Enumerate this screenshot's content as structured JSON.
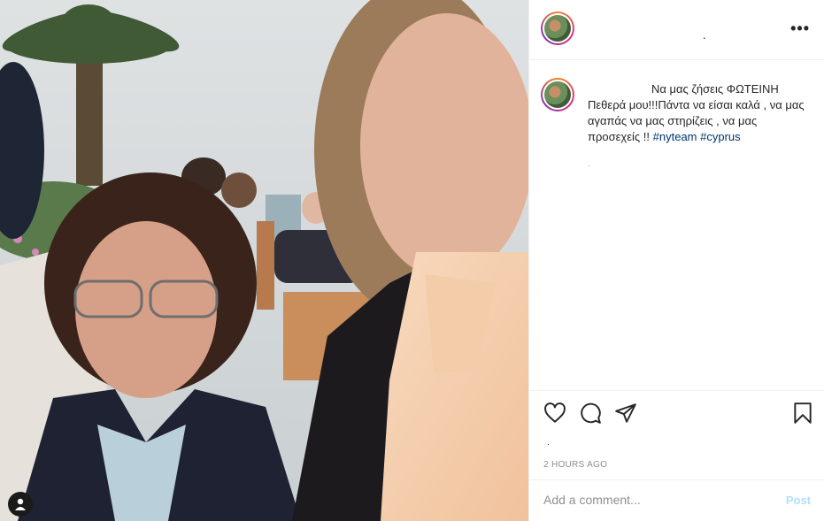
{
  "post": {
    "username": ".",
    "caption_lead": "Να μας ζήσεις ΦΩΤΕΙΝΗ",
    "caption_body": "Πεθερά μου!!!Πάντα να είσαι καλά , να μας αγαπάς να μας στηρίζεις , να μας προσεχείς !! ",
    "hashtags": [
      "#nyteam",
      "#cyprus"
    ],
    "caption_dot": ".",
    "likes_dot": ".",
    "timestamp": "2 HOURS AGO"
  },
  "comment": {
    "placeholder": "Add a comment...",
    "post_label": "Post"
  },
  "colors": {
    "accent": "#0095f6",
    "post_disabled": "#b2dffc",
    "hashtag": "#00376b",
    "secondary_text": "#8e8e8e"
  },
  "icons": [
    "more-icon",
    "heart-icon",
    "comment-icon",
    "share-icon",
    "bookmark-icon",
    "user-tag-icon"
  ]
}
